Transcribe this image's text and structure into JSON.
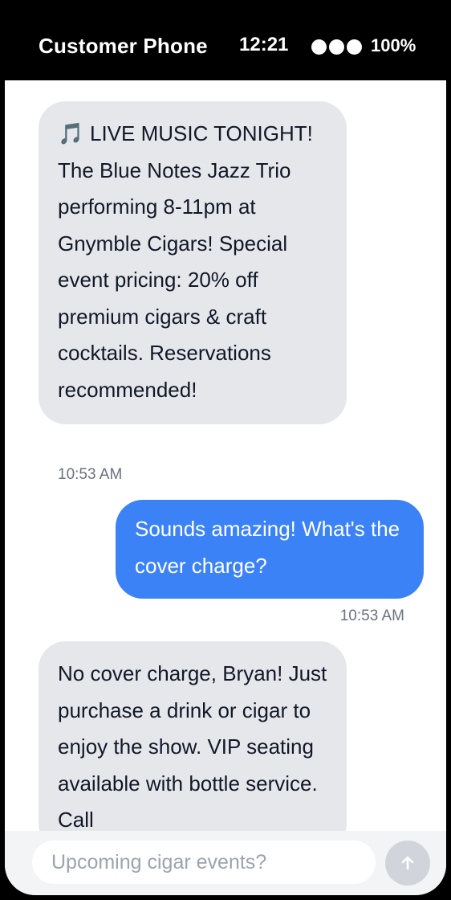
{
  "status": {
    "title": "Customer Phone",
    "time": "12:21",
    "battery": "100%"
  },
  "messages": [
    {
      "direction": "incoming",
      "emoji": "🎵",
      "text": "LIVE MUSIC TONIGHT! The Blue Notes Jazz Trio performing 8-11pm at Gnymble Cigars! Special event pricing: 20% off premium cigars & craft cocktails. Reservations recommended!",
      "time": "10:53 AM"
    },
    {
      "direction": "outgoing",
      "text": "Sounds amazing! What's the cover charge?",
      "time": "10:53 AM"
    },
    {
      "direction": "incoming",
      "text": "No cover charge, Bryan! Just purchase a drink or cigar to enjoy the show. VIP seating available with bottle service. Call",
      "time": ""
    }
  ],
  "composer": {
    "placeholder": "Upcoming cigar events?"
  },
  "colors": {
    "incoming_bubble": "#e5e7eb",
    "outgoing_bubble": "#3b82f6",
    "send_button": "#d1d5db"
  },
  "icons": {
    "send": "arrow-up-icon",
    "signal": "signal-dots-icon"
  }
}
